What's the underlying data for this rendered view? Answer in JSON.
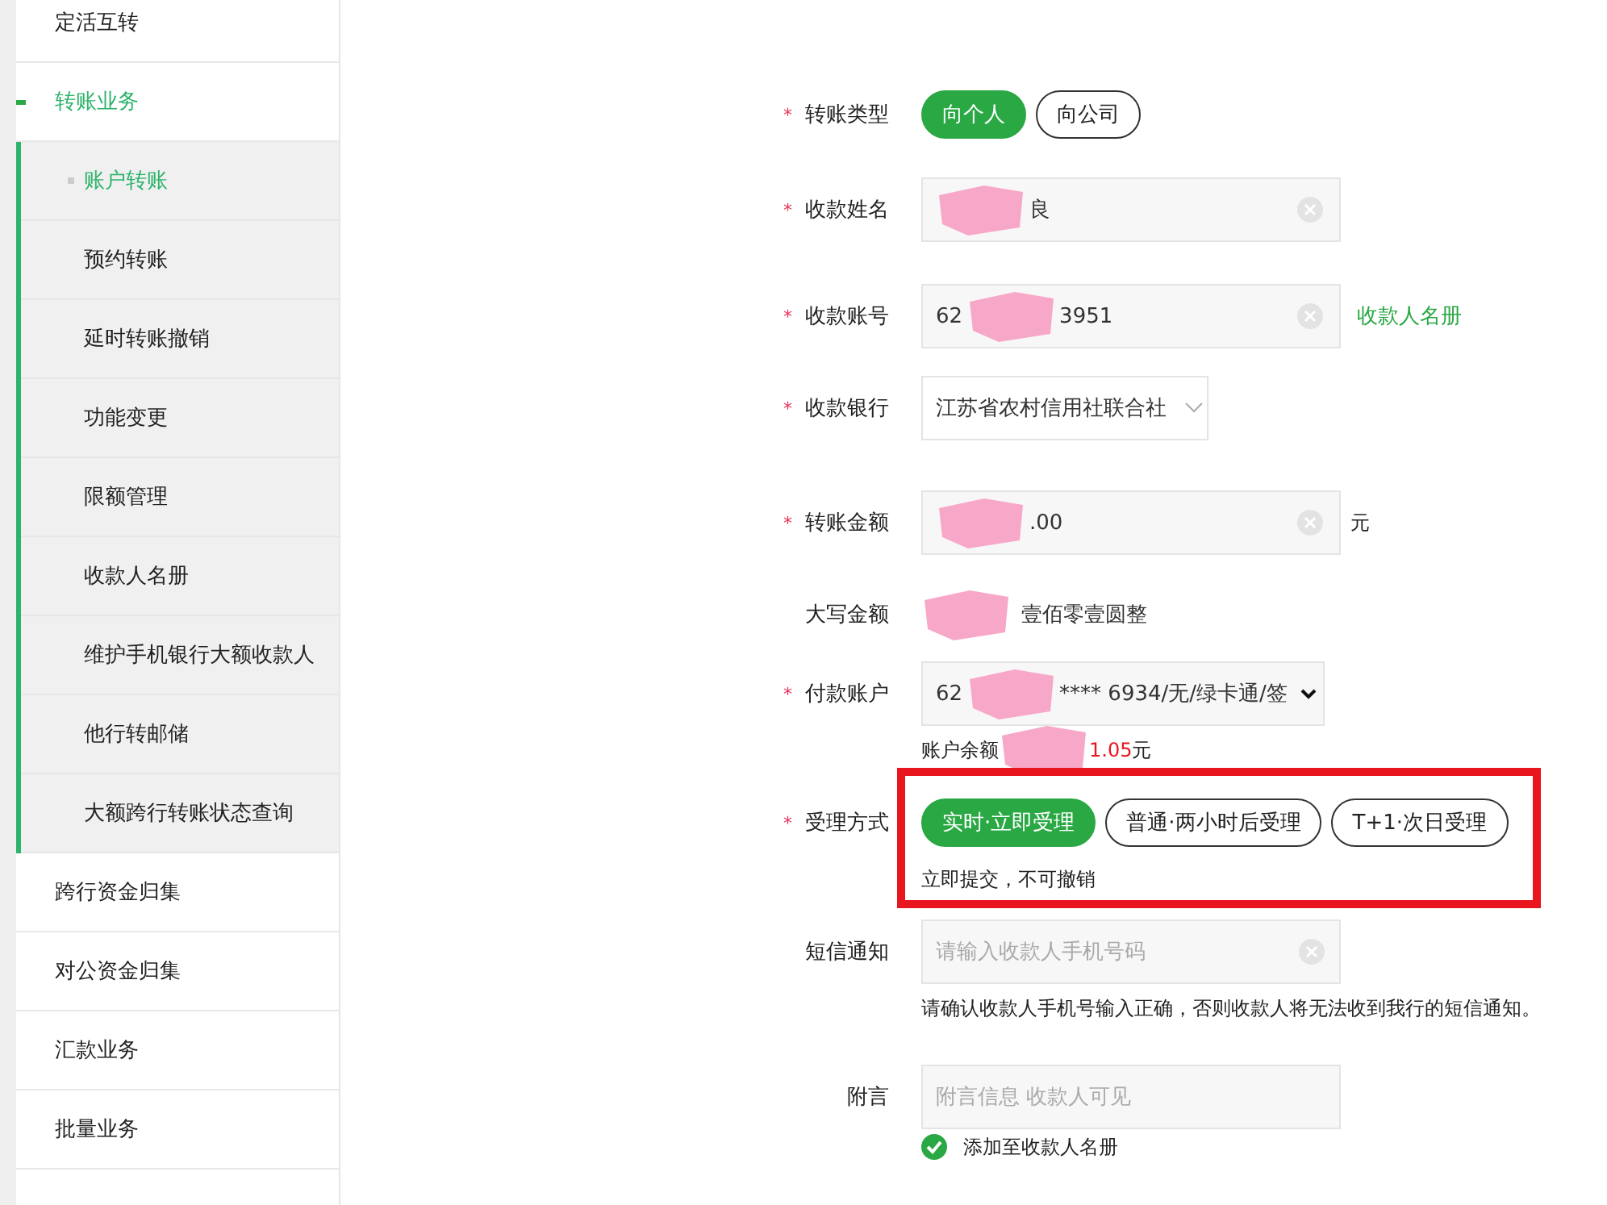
{
  "sidebar": {
    "items": [
      {
        "label": "定活互转",
        "selected": false
      },
      {
        "label": "转账业务",
        "selected": true,
        "children": [
          {
            "label": "账户转账",
            "selected": true
          },
          {
            "label": "预约转账",
            "selected": false
          },
          {
            "label": "延时转账撤销",
            "selected": false
          },
          {
            "label": "功能变更",
            "selected": false
          },
          {
            "label": "限额管理",
            "selected": false
          },
          {
            "label": "收款人名册",
            "selected": false
          },
          {
            "label": "维护手机银行大额收款人",
            "selected": false
          },
          {
            "label": "他行转邮储",
            "selected": false
          },
          {
            "label": "大额跨行转账状态查询",
            "selected": false
          }
        ]
      },
      {
        "label": "跨行资金归集",
        "selected": false
      },
      {
        "label": "对公资金归集",
        "selected": false
      },
      {
        "label": "汇款业务",
        "selected": false
      },
      {
        "label": "批量业务",
        "selected": false
      }
    ]
  },
  "form": {
    "rows": [
      {
        "kind": "choice",
        "label": "转账类型",
        "required_mark": "*",
        "options": [
          {
            "label": "向个人",
            "selected": true
          },
          {
            "label": "向公司",
            "selected": false
          }
        ]
      },
      {
        "kind": "input",
        "label": "收款姓名",
        "required_mark": "*",
        "parts": [
          {
            "kind": "redaction"
          },
          {
            "kind": "text",
            "text": "良"
          }
        ]
      },
      {
        "kind": "input",
        "label": "收款账号",
        "required_mark": "*",
        "parts": [
          {
            "kind": "text",
            "text": "62"
          },
          {
            "kind": "redaction"
          },
          {
            "kind": "text",
            "text": "3951"
          }
        ],
        "link": "收款人名册"
      },
      {
        "kind": "select",
        "label": "收款银行",
        "required_mark": "*",
        "value": "江苏省农村信用社联合社"
      },
      {
        "kind": "input",
        "label": "转账金额",
        "required_mark": "*",
        "parts": [
          {
            "kind": "redaction"
          },
          {
            "kind": "text",
            "text": ".00"
          }
        ],
        "unit": "元"
      },
      {
        "kind": "static",
        "label": "大写金额",
        "parts": [
          {
            "kind": "redaction"
          },
          {
            "kind": "text",
            "text": "壹佰零壹圆整"
          }
        ]
      },
      {
        "kind": "dropdown",
        "label": "付款账户",
        "required_mark": "*",
        "parts": [
          {
            "kind": "text",
            "text": "62"
          },
          {
            "kind": "redaction"
          },
          {
            "kind": "text",
            "text": "**** 6934/无/绿卡通/签"
          }
        ],
        "balance_label": "账户余额",
        "balance": "1.05",
        "balance_unit": "元"
      },
      {
        "kind": "choice",
        "label": "受理方式",
        "required_mark": "*",
        "highlighted": true,
        "options": [
          {
            "label": "实时·立即受理",
            "selected": true
          },
          {
            "label": "普通·两小时后受理",
            "selected": false
          },
          {
            "label": "T+1·次日受理",
            "selected": false
          }
        ],
        "hint": "立即提交，不可撤销"
      },
      {
        "kind": "input",
        "label": "短信通知",
        "placeholder": "请输入收款人手机号码",
        "notice": "请确认收款人手机号输入正确，否则收款人将无法收到我行的短信通知。"
      },
      {
        "kind": "input",
        "label": "附言",
        "placeholder": "附言信息 收款人可见",
        "clearable": false
      },
      {
        "kind": "checkbox",
        "label": "添加至收款人名册",
        "checked": true
      }
    ]
  }
}
